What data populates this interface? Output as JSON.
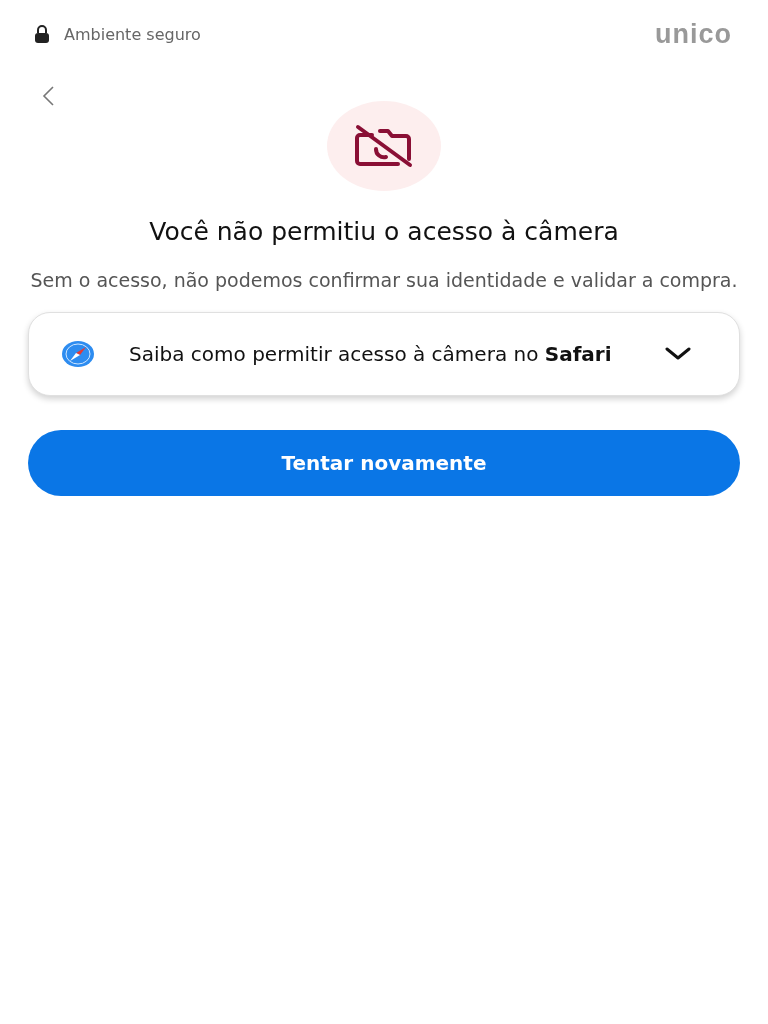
{
  "header": {
    "secure_label": "Ambiente seguro",
    "logo": "unico"
  },
  "title": "Você não permitiu o acesso à câmera",
  "subtitle": "Sem o acesso, não podemos confirmar sua identidade e validar a compra.",
  "help": {
    "text": "Saiba como permitir acesso à câmera no **Safari**",
    "expanded": false
  },
  "retry_button": "Tentar novamente"
}
